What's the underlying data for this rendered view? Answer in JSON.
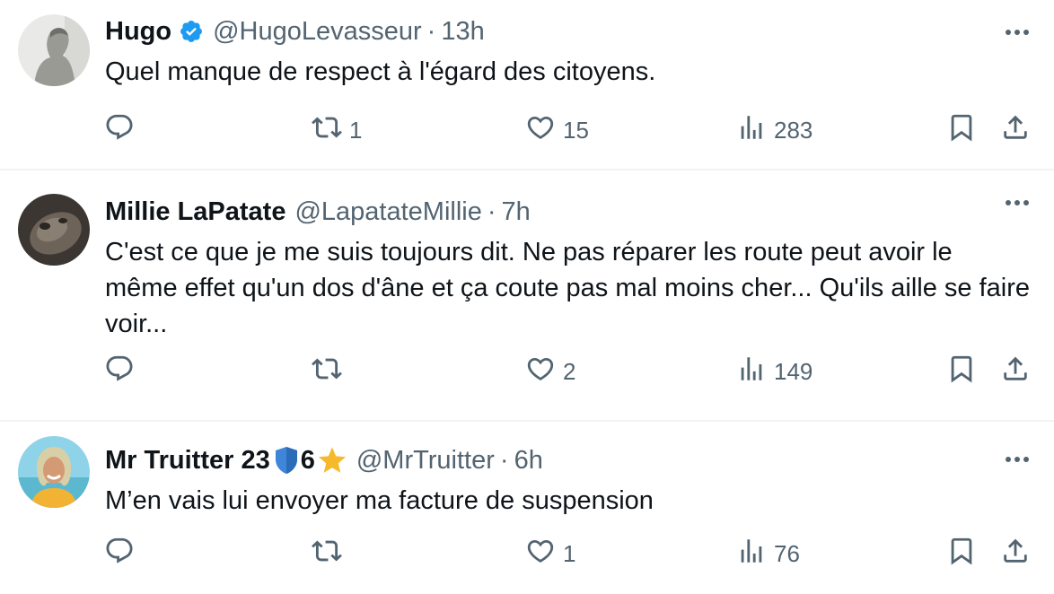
{
  "colors": {
    "verified": "#1d9bf0",
    "text_primary": "#0f1419",
    "text_secondary": "#536471",
    "divider": "#eff3f4",
    "shield": "#3f86d8",
    "star": "#f7b92c"
  },
  "tweets": [
    {
      "name": "Hugo",
      "verified": true,
      "handle": "@HugoLevasseur",
      "separator": "·",
      "time": "13h",
      "text": "Quel manque de respect à l'égard des citoyens.",
      "retweets": "1",
      "likes": "15",
      "views": "283"
    },
    {
      "name": "Millie LaPatate",
      "handle": "@LapatateMillie",
      "separator": "·",
      "time": "7h",
      "text": "C'est ce que je me suis toujours dit. Ne pas réparer les route peut avoir le même effet qu'un dos d'âne et ça coute pas mal moins cher... Qu'ils aille se faire voir...",
      "retweets": "",
      "likes": "2",
      "views": "149"
    },
    {
      "name": "Mr Truitter 23",
      "name_badge_icon": "blue-shield-emoji",
      "name_suffix": "6",
      "name_suffix_icon": "star-emoji",
      "handle": "@MrTruitter",
      "separator": "·",
      "time": "6h",
      "text": "M’en vais lui envoyer ma facture de suspension",
      "retweets": "",
      "likes": "1",
      "views": "76"
    }
  ],
  "icons": [
    "reply-icon",
    "retweet-icon",
    "like-icon",
    "views-icon",
    "bookmark-icon",
    "share-icon",
    "more-icon",
    "verified-badge-icon"
  ]
}
